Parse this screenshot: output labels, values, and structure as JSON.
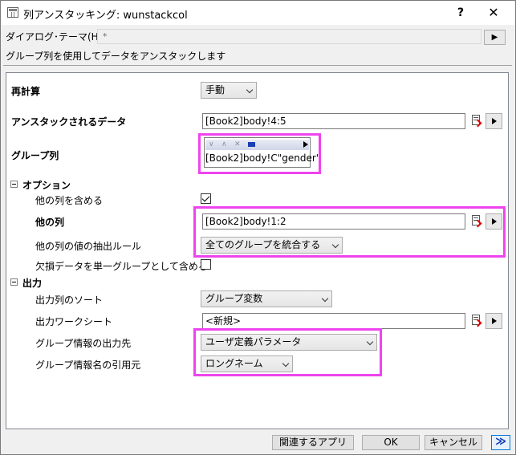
{
  "window": {
    "title": "列アンスタッキング: wunstackcol",
    "help_label": "?",
    "close_label": "✕"
  },
  "theme": {
    "label": "ダイアログ･テーマ(H)",
    "value": "*",
    "arrow": "▶"
  },
  "description": "グループ列を使用してデータをアンスタックします",
  "panel": {
    "recalc": {
      "label": "再計算",
      "value": "手動"
    },
    "unstack_data": {
      "label": "アンスタックされるデータ",
      "value": "[Book2]body!4:5"
    },
    "group_col": {
      "label": "グループ列",
      "value": "[Book2]body!C\"gender\"",
      "toolbar": {
        "down": "∨",
        "up": "∧",
        "remove": "✕"
      }
    },
    "options": {
      "label": "オプション",
      "include_other": {
        "label": "他の列を含める",
        "checked": true
      },
      "other_cols": {
        "label": "他の列",
        "value": "[Book2]body!1:2"
      },
      "extract_rule": {
        "label": "他の列の値の抽出ルール",
        "value": "全てのグループを統合する"
      },
      "missing_single": {
        "label": "欠損データを単一グループとして含める",
        "checked": false
      }
    },
    "output": {
      "label": "出力",
      "sort": {
        "label": "出力列のソート",
        "value": "グループ変数"
      },
      "worksheet": {
        "label": "出力ワークシート",
        "value": "<新規>"
      },
      "info_dest": {
        "label": "グループ情報の出力先",
        "value": "ユーザ定義パラメータ"
      },
      "info_source": {
        "label": "グループ情報名の引用元",
        "value": "ロングネーム"
      }
    }
  },
  "buttons": {
    "related_apps": "関連するアプリ",
    "ok": "OK",
    "cancel": "キャンセル",
    "expand": "≫"
  },
  "colors": {
    "highlight": "#ee44ee",
    "accent": "#0078d7"
  }
}
